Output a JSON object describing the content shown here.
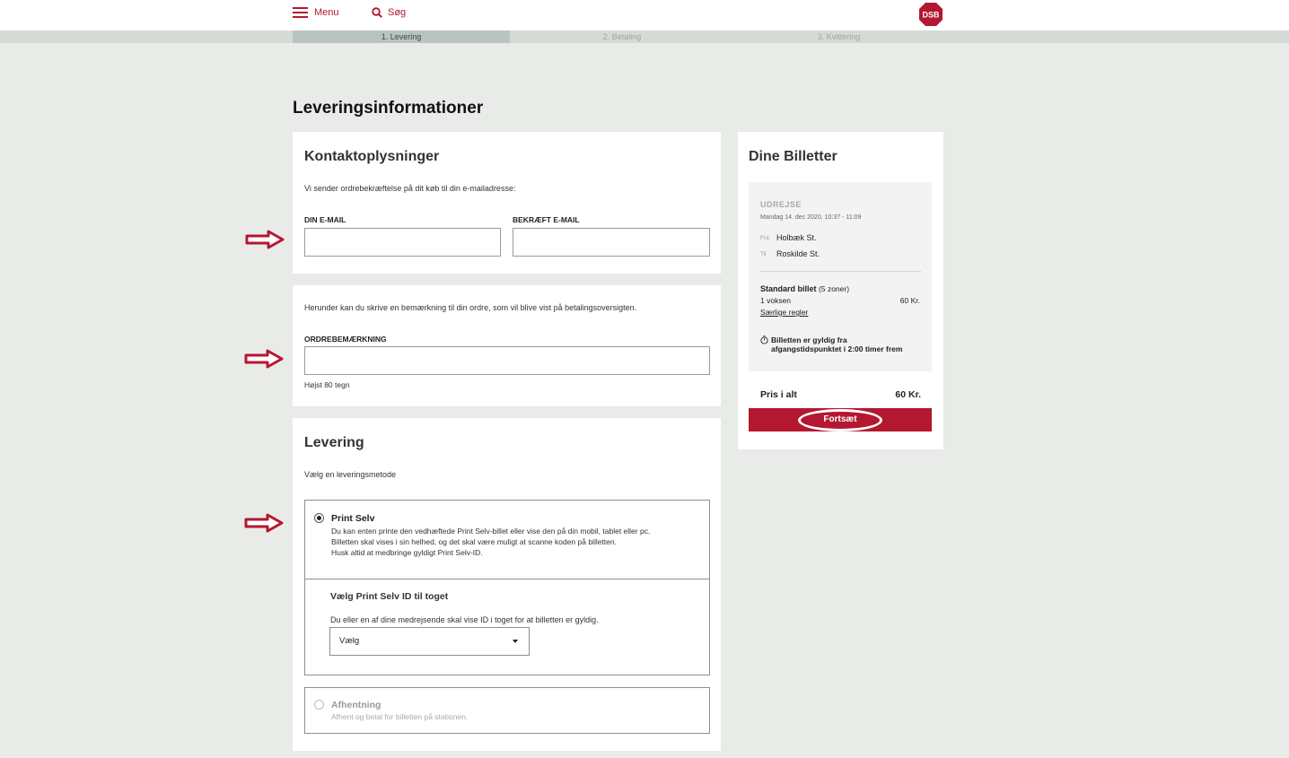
{
  "header": {
    "menu_label": "Menu",
    "search_label": "Søg",
    "logo_text": "DSB",
    "menu_icon": "hamburger-menu-icon",
    "search_icon": "search-icon"
  },
  "steps": [
    "1. Levering",
    "2. Betaling",
    "3. Kvittering"
  ],
  "page_title": "Leveringsinformationer",
  "contact": {
    "title": "Kontaktoplysninger",
    "intro": "Vi sender ordrebekræftelse på dit køb til din e-mailadresse:",
    "email_label": "DIN E-MAIL",
    "email_value": "",
    "confirm_label": "BEKRÆFT E-MAIL",
    "confirm_value": ""
  },
  "remark": {
    "intro": "Herunder kan du skrive en bemærkning til din ordre, som vil blive vist på betalingsoversigten.",
    "label": "ORDREBEMÆRKNING",
    "value": "",
    "hint": "Højst 80 tegn"
  },
  "delivery": {
    "title": "Levering",
    "intro": "Vælg en leveringsmetode",
    "print": {
      "title": "Print Selv",
      "selected": true,
      "lines": [
        "Du kan enten printe den vedhæftede Print Selv-billet eller vise den på din mobil, tablet eller pc.",
        "Billetten skal vises i sin helhed, og det skal være muligt at scanne koden på billetten.",
        "Husk altid at medbringe gyldigt Print Selv-ID."
      ]
    },
    "id": {
      "title": "Vælg Print Selv ID til toget",
      "text": "Du eller en af dine medrejsende skal vise ID i toget for at billetten er gyldig.",
      "select_value": "Vælg"
    },
    "pickup": {
      "title": "Afhentning",
      "selected": false,
      "text": "Afhent og betal for billetten på stationen."
    }
  },
  "tickets": {
    "title": "Dine Billetter",
    "direction": "UDREJSE",
    "date": "Mandag 14. dec 2020, 10:37 - 11:09",
    "from_label": "Fra",
    "from": "Holbæk St.",
    "to_label": "Til",
    "to": "Roskilde St.",
    "ticket_name": "Standard billet",
    "ticket_zones": "(5 zoner)",
    "passengers": "1 voksen",
    "ticket_price": "60 Kr.",
    "rules_link": "Særlige regler",
    "validity_line1": "Billetten er gyldig fra",
    "validity_line2": "afgangstidspunktet i 2:00 timer frem",
    "validity_icon": "stopwatch-icon",
    "total_label": "Pris i alt",
    "total_value": "60 Kr.",
    "continue_label": "Fortsæt"
  },
  "annotations": {
    "arrow_icon": "red-arrow-icon",
    "arrow_color": "#b41730"
  },
  "colors": {
    "brand": "#b41730",
    "background": "#e9ebe9",
    "active_step": "#b9c4be"
  }
}
